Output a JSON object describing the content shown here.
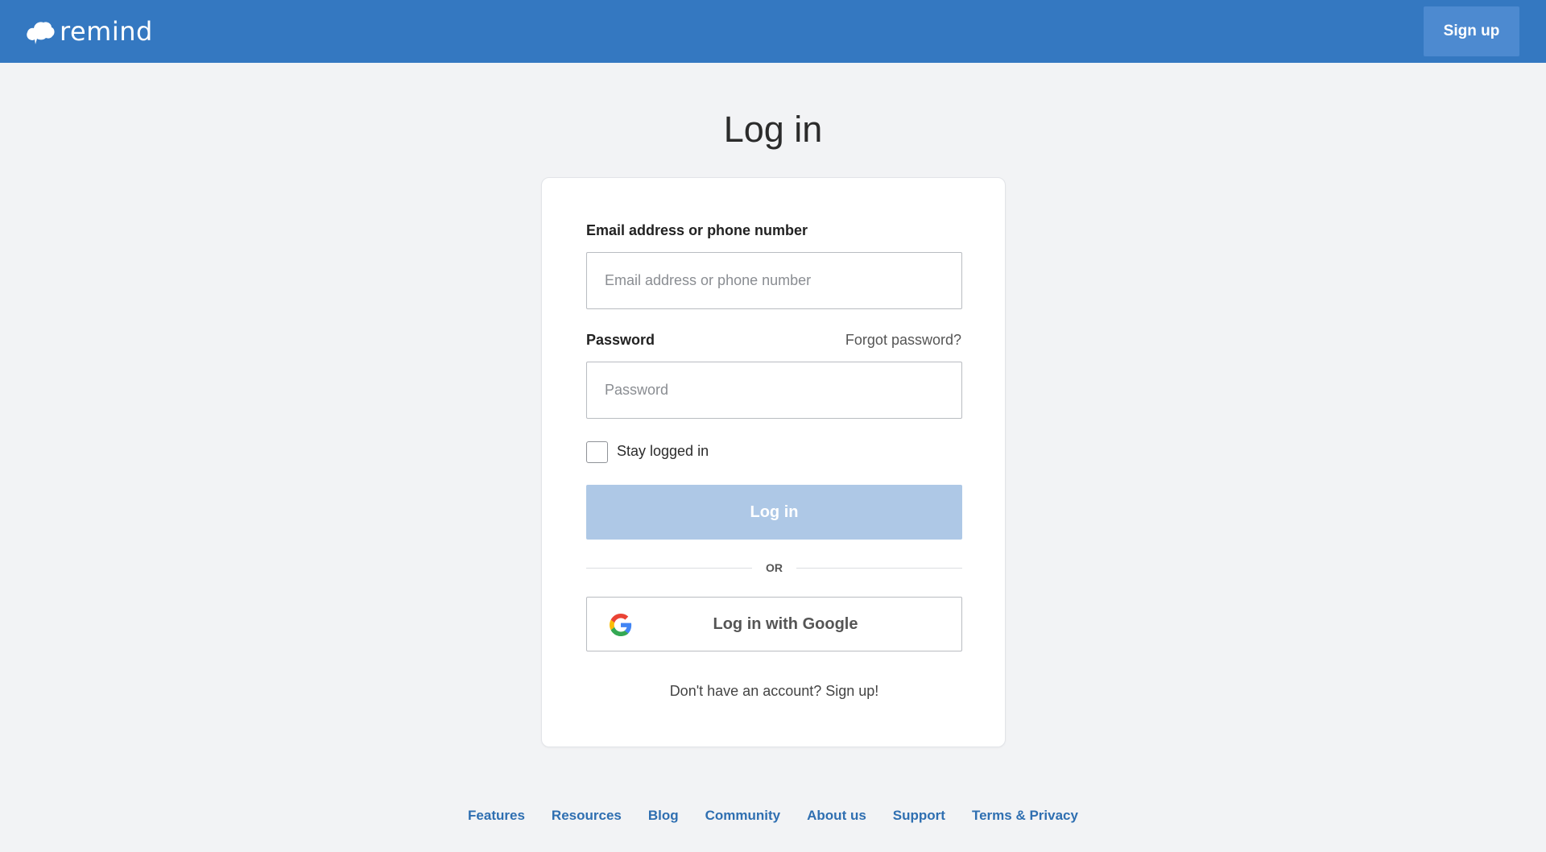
{
  "header": {
    "logo_text": "remind",
    "signup_label": "Sign up"
  },
  "page": {
    "title": "Log in"
  },
  "form": {
    "email_label": "Email address or phone number",
    "email_placeholder": "Email address or phone number",
    "email_value": "",
    "password_label": "Password",
    "forgot_label": "Forgot password?",
    "password_placeholder": "Password",
    "password_value": "",
    "stay_logged_in_label": "Stay logged in",
    "stay_logged_in_checked": false,
    "login_button_label": "Log in",
    "divider_text": "OR",
    "google_button_label": "Log in with Google",
    "no_account_text": "Don't have an account? Sign up!"
  },
  "footer": {
    "links": [
      "Features",
      "Resources",
      "Blog",
      "Community",
      "About us",
      "Support",
      "Terms & Privacy"
    ]
  },
  "colors": {
    "header_bg": "#3478c1",
    "signup_bg": "#4d8ad0",
    "page_bg": "#f2f3f5",
    "login_button_disabled": "#aec8e6",
    "footer_link": "#2f6fb1"
  },
  "icons": {
    "logo": "remind-cloud-icon",
    "google": "google-g-icon"
  }
}
